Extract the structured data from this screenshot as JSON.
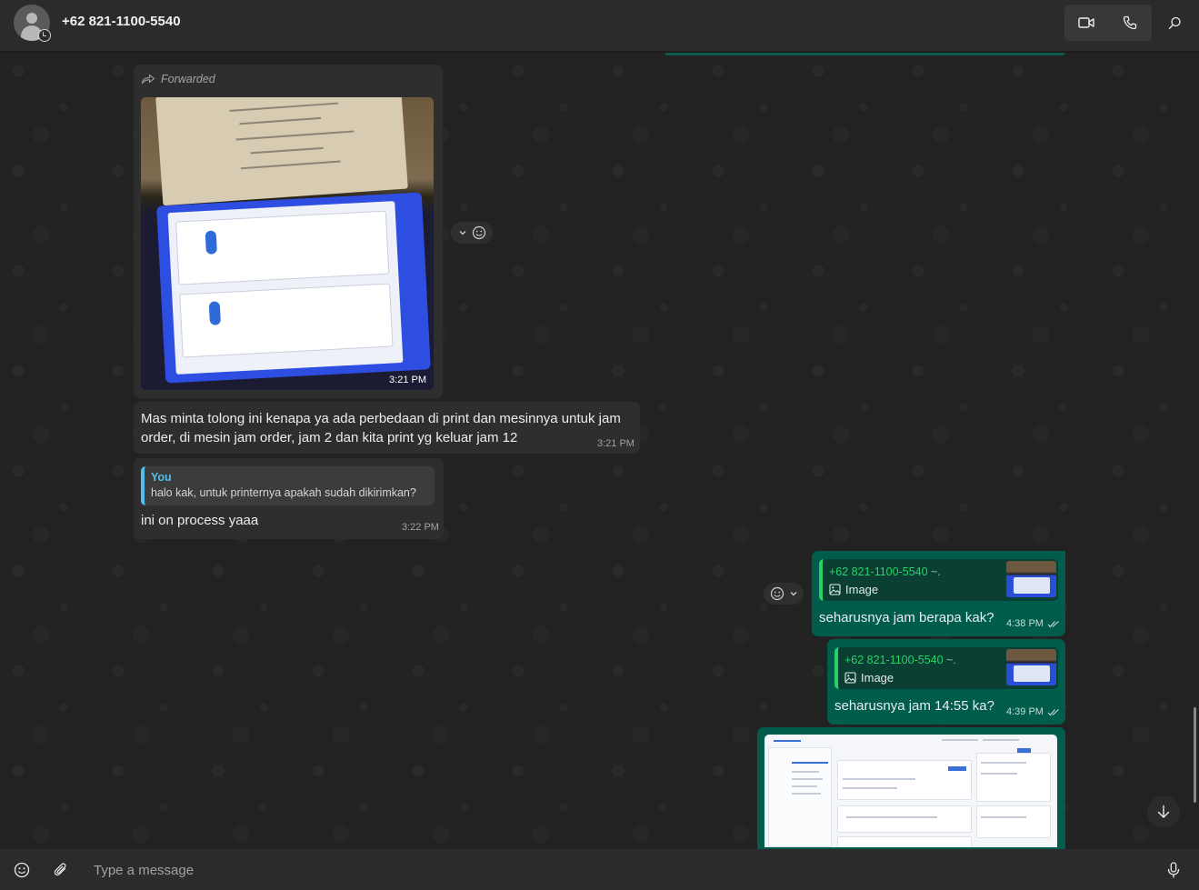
{
  "header": {
    "contact_name": "+62 821-1100-5540",
    "icons": [
      "avatar",
      "video-call-icon",
      "voice-call-icon",
      "search-icon"
    ]
  },
  "messages": {
    "forwarded_photo": {
      "forwarded_label": "Forwarded",
      "time": "3:21 PM"
    },
    "text_1": {
      "line1": "Mas minta tolong ini kenapa ya ada perbedaan di print dan mesinnya untuk jam",
      "line2": "order, di mesin jam order, jam 2 dan kita print yg keluar jam 12",
      "time": "3:21 PM"
    },
    "reply_in": {
      "quote_author": "You",
      "quote_text": "halo kak, untuk printernya apakah sudah dikirimkan?",
      "text": "ini on process yaaa",
      "time": "3:22 PM"
    },
    "reply_out_1": {
      "quote_author": "+62 821-1100-5540",
      "quote_tilde": "~.",
      "quote_label": "Image",
      "text": "seharusnya jam berapa kak?",
      "time": "4:38 PM"
    },
    "reply_out_2": {
      "quote_author": "+62 821-1100-5540",
      "quote_tilde": "~.",
      "quote_label": "Image",
      "text": "seharusnya jam 14:55 ka?",
      "time": "4:39 PM"
    }
  },
  "composer": {
    "placeholder": "Type a message"
  },
  "colors": {
    "incoming_bubble": "#2e2e2e",
    "outgoing_bubble": "#005c4b",
    "quote_accent_in": "#53bdeb",
    "quote_accent_out": "#25d366"
  }
}
